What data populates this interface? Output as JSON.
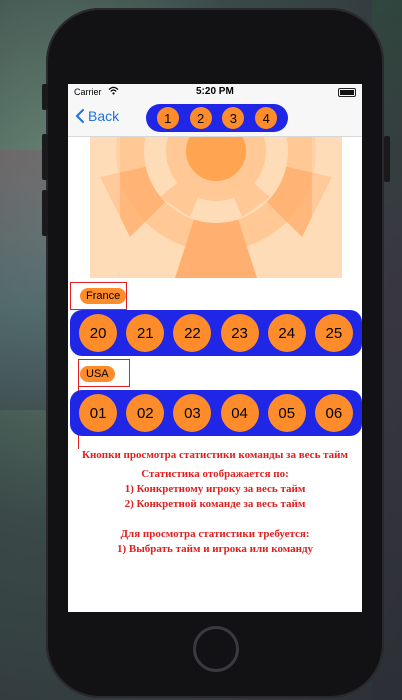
{
  "status": {
    "carrier": "Carrier",
    "time": "5:20 PM"
  },
  "nav": {
    "back_label": "Back",
    "segments": [
      "1",
      "2",
      "3",
      "4"
    ]
  },
  "teams": [
    {
      "name": "France",
      "players": [
        "20",
        "21",
        "22",
        "23",
        "24",
        "25"
      ]
    },
    {
      "name": "USA",
      "players": [
        "01",
        "02",
        "03",
        "04",
        "05",
        "06"
      ]
    }
  ],
  "notes": {
    "line1": "Кнопки просмотра статистики команды за весь тайм",
    "line2": "Статистика отображается по:",
    "line3": "1) Конкретному игроку за весь тайм",
    "line4": "2) Конкретной команде за весь тайм",
    "line5": "Для просмотра статистики требуется:",
    "line6": "1) Выбрать тайм и игрока или команду"
  },
  "colors": {
    "accent_blue": "#1f26e6",
    "button_orange": "#ff8c2a",
    "annotation_red": "#e02020",
    "link_blue": "#1a73e8"
  },
  "icons": [
    "wifi-icon",
    "battery-icon",
    "chevron-left-icon",
    "home-button-icon"
  ]
}
